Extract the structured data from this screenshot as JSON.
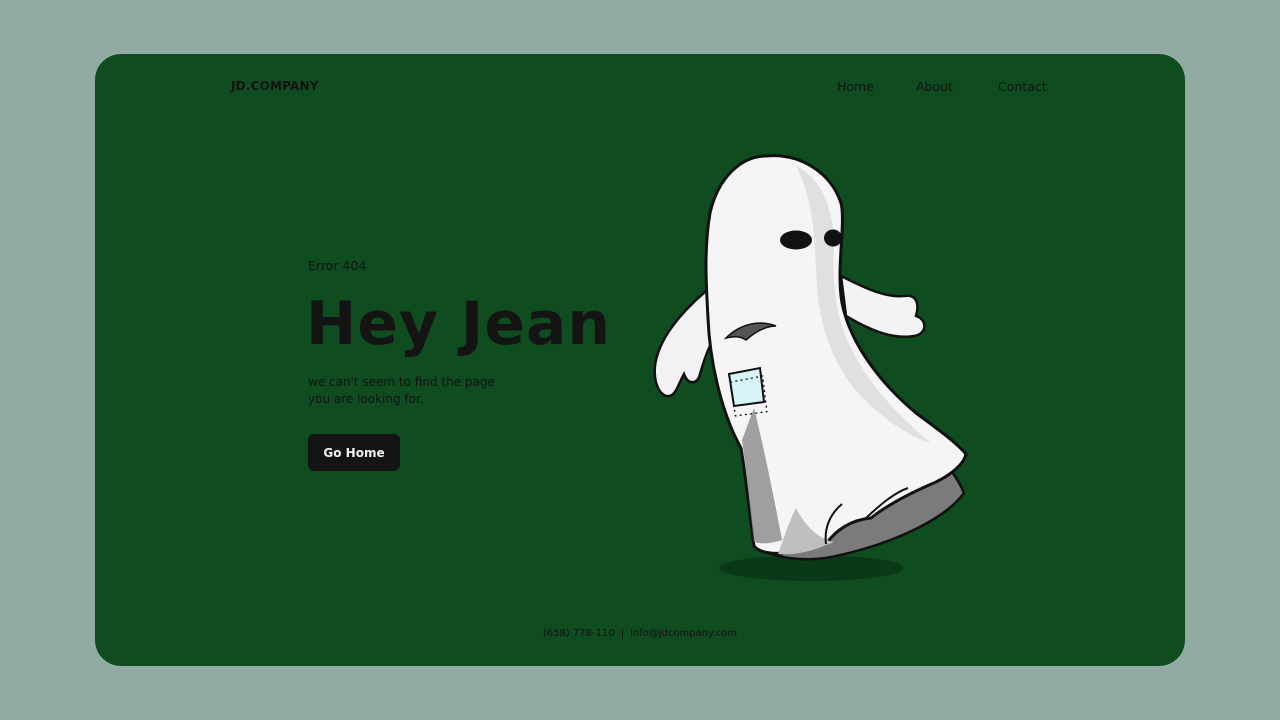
{
  "brand": "JD.COMPANY",
  "nav": {
    "home": "Home",
    "about": "About",
    "contact": "Contact"
  },
  "hero": {
    "eyebrow": "Error 404",
    "title": "Hey Jean",
    "message_line1": "we can't seem to find the page",
    "message_line2": "you are looking for.",
    "button": "Go Home"
  },
  "illustration": "ghost-illustration",
  "footer": {
    "phone": "(658) 778-110",
    "separator": "|",
    "email": "info@jdcompany.com"
  },
  "colors": {
    "page_background": "#91aba2",
    "card_background": "#0f4d20",
    "text": "#141414",
    "button_background": "#141414",
    "button_text": "#f2f2f2"
  }
}
